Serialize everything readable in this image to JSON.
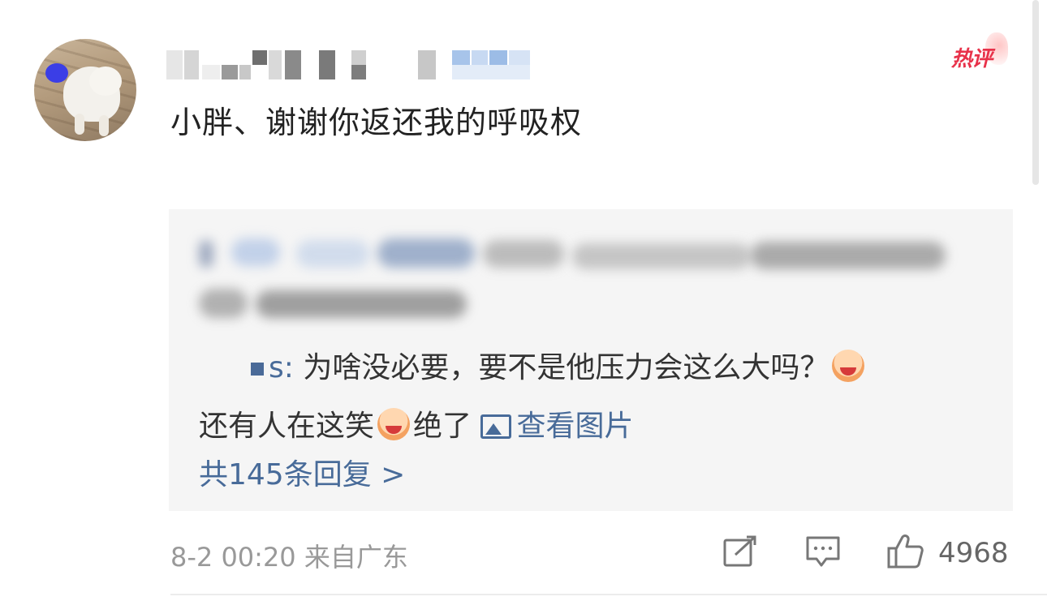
{
  "comment": {
    "text": "小胖、谢谢你返还我的呼吸权",
    "hot_badge": "热评"
  },
  "replies": {
    "reply2_name_suffix": "s:",
    "reply2_text_a": " 为啥没必要，要不是他压力会这么大吗？",
    "reply2_text_b": "还有人在这笑",
    "reply2_text_c": "绝了",
    "view_image_label": "查看图片",
    "total_label": "共145条回复 >"
  },
  "footer": {
    "meta": "8-2 00:20 来自广东",
    "like_count": "4968"
  },
  "icons": {
    "share": "edit-share-icon",
    "comment": "comment-icon",
    "like": "thumbs-up-icon",
    "image": "image-icon",
    "emoji": "laughing-emoji-icon"
  },
  "colors": {
    "link_blue": "#486b99",
    "hot_red": "#e8324a",
    "meta_gray": "#999999",
    "reply_bg": "#f5f5f5"
  }
}
